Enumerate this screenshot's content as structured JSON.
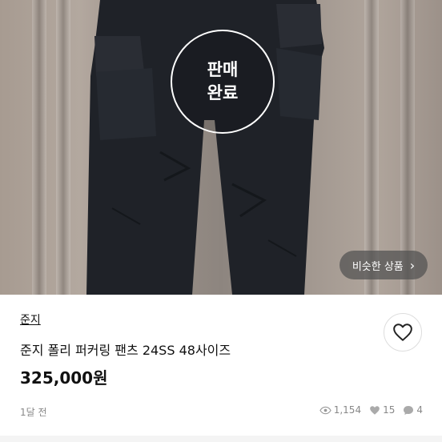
{
  "photo": {
    "sold_badge": [
      "판매",
      "완료"
    ],
    "similar_button": {
      "label": "비슷한 상품",
      "chevron": "›"
    }
  },
  "product": {
    "seller": "준지",
    "title": "준지 폴리 퍼커링 팬츠 24SS 48사이즈",
    "price": "325,000원",
    "time": "1달 전"
  },
  "stats": {
    "views": "1,154",
    "likes": "15",
    "chats": "4"
  },
  "icons": {
    "like": "heart-outline-icon",
    "views": "eye-icon",
    "likes": "heart-icon",
    "chats": "chat-bubble-icon"
  },
  "colors": {
    "text": "#111111",
    "muted": "#888888",
    "badge_border": "#ffffff"
  }
}
